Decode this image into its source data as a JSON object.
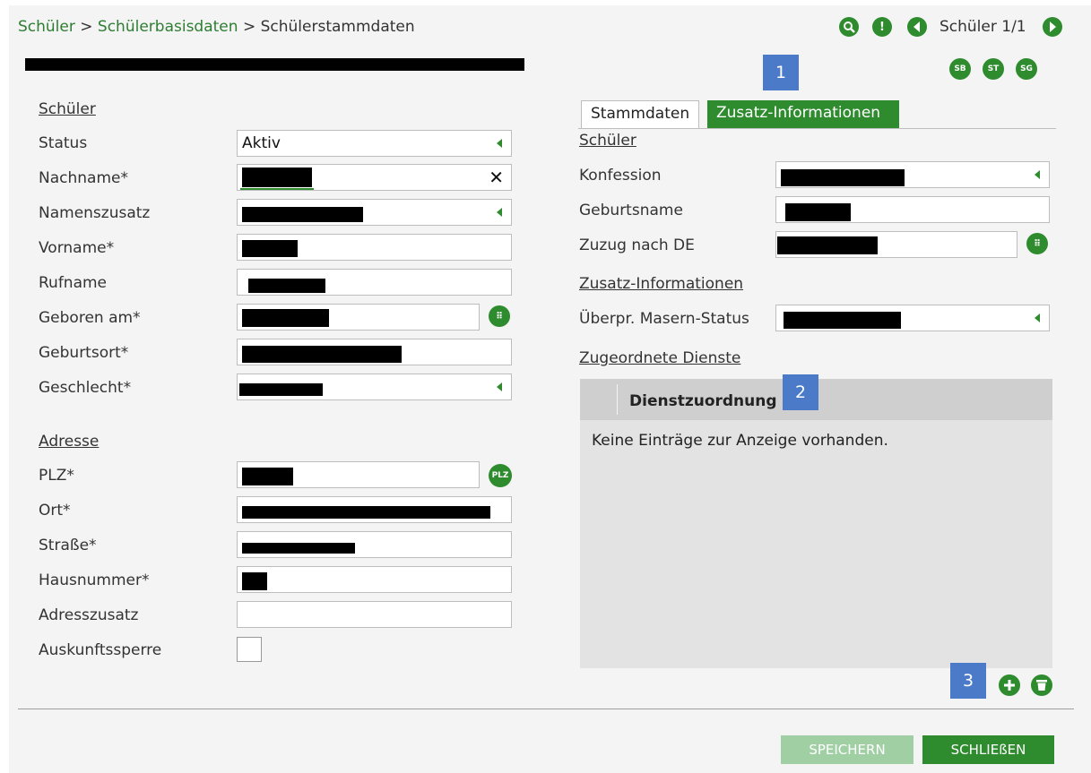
{
  "breadcrumb": {
    "part1": "Schüler",
    "sep1": " > ",
    "part2": "Schülerbasisdaten",
    "sep2": " > ",
    "part3": "Schülerstammdaten"
  },
  "nav": {
    "student_counter": "Schüler 1/1"
  },
  "header_icons": {
    "sb": "SB",
    "st": "ST",
    "sg": "SG"
  },
  "tabs": [
    {
      "label": "Stammdaten"
    },
    {
      "label": "Zusatz-Informationen"
    }
  ],
  "left": {
    "section_schueler": "Schüler",
    "section_adresse": "Adresse",
    "labels": {
      "status": "Status",
      "nachname": "Nachname*",
      "namenszusatz": "Namenszusatz",
      "vorname": "Vorname*",
      "rufname": "Rufname",
      "geboren": "Geboren am*",
      "geburtsort": "Geburtsort*",
      "geschlecht": "Geschlecht*",
      "plz": "PLZ*",
      "ort": "Ort*",
      "strasse": "Straße*",
      "hausnummer": "Hausnummer*",
      "adresszusatz": "Adresszusatz",
      "auskunftssperre": "Auskunftssperre"
    },
    "status_value": "Aktiv",
    "plz_button": "PLZ"
  },
  "right": {
    "section_schueler": "Schüler",
    "section_zusatz": "Zusatz-Informationen",
    "section_dienste": "Zugeordnete Dienste",
    "labels": {
      "konfession": "Konfession",
      "geburtsname": "Geburtsname",
      "zuzug": "Zuzug nach DE",
      "masern": "Überpr. Masern-Status"
    },
    "table": {
      "header": "Dienstzuordnung",
      "empty": "Keine Einträge zur Anzeige vorhanden."
    }
  },
  "badges": {
    "b1": "1",
    "b2": "2",
    "b3": "3"
  },
  "footer": {
    "save": "SPEICHERN",
    "close": "SCHLIEßEN"
  },
  "colors": {
    "green": "#2e8b2e",
    "save_disabled": "#9fcfa3",
    "badge_blue": "#4a7ac8"
  }
}
